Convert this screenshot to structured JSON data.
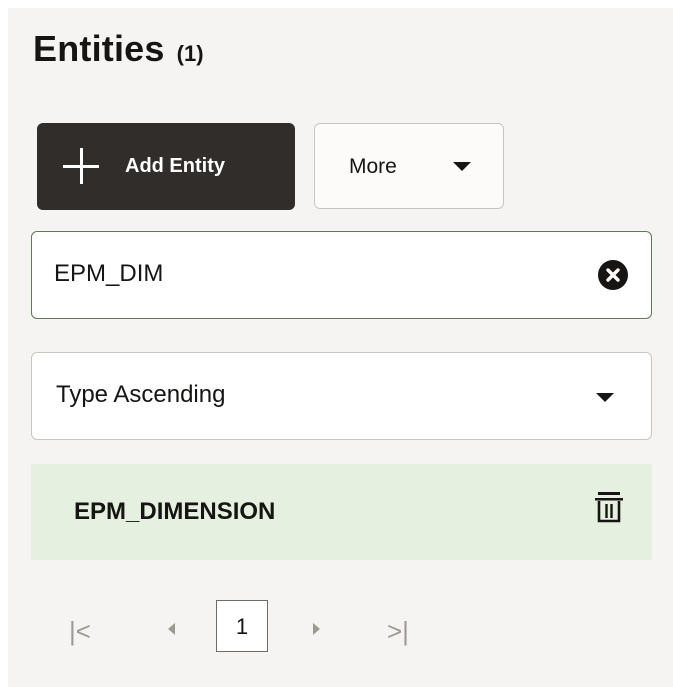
{
  "header": {
    "title": "Entities",
    "count": "(1)"
  },
  "toolbar": {
    "add_label": "Add Entity",
    "more_label": "More"
  },
  "search": {
    "value": "EPM_DIM",
    "icons": {
      "clear": "clear-circle-icon"
    }
  },
  "sort": {
    "selected": "Type Ascending"
  },
  "list": {
    "items": [
      {
        "label": "EPM_DIMENSION",
        "selected": true,
        "icon": "trash-icon"
      }
    ]
  },
  "pagination": {
    "current_page": "1",
    "first": "|<",
    "last": ">|"
  },
  "colors": {
    "primary_button": "#312d2a",
    "selected_row": "#e6f0e0",
    "search_border": "#5d7a57",
    "panel_bg": "#f5f4f2"
  }
}
